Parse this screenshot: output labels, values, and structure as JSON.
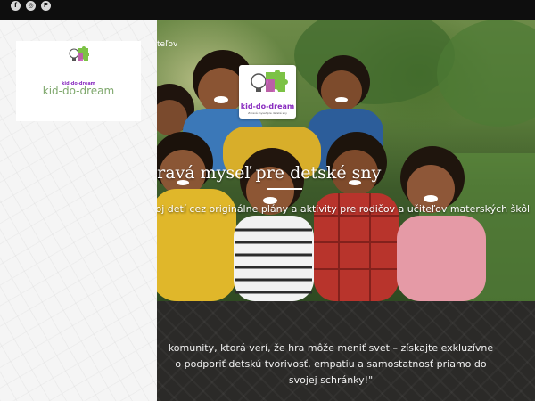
{
  "social": {
    "facebook_glyph": "f",
    "instagram_glyph": "◎",
    "pinterest_glyph": "P"
  },
  "nav": {
    "fragment": "teľov"
  },
  "side_panel": {
    "logo_text": "kid-do-dream",
    "brand": "kid-do-dream"
  },
  "hero": {
    "logo_text": "kid-do-dream",
    "logo_tagline": "Zdravá myseľ pre detské sny",
    "title": "dravá myseľ pre detské sny",
    "subtitle": "voj detí cez originálne plány a aktivity pre rodičov a učiteľov materských škôl"
  },
  "quote": {
    "line1": "komunity, ktorá verí, že hra môže meniť svet – získajte exkluzívne",
    "line2": "o podporiť detskú tvorivosť, empatiu a samostatnosť priamo do",
    "line3": "svojej schránky!\""
  },
  "colors": {
    "topbar": "#0e0e0e",
    "brand_green": "#7fa86d",
    "brand_purple": "#8a2ec0",
    "dark_section": "#2b2a28"
  }
}
